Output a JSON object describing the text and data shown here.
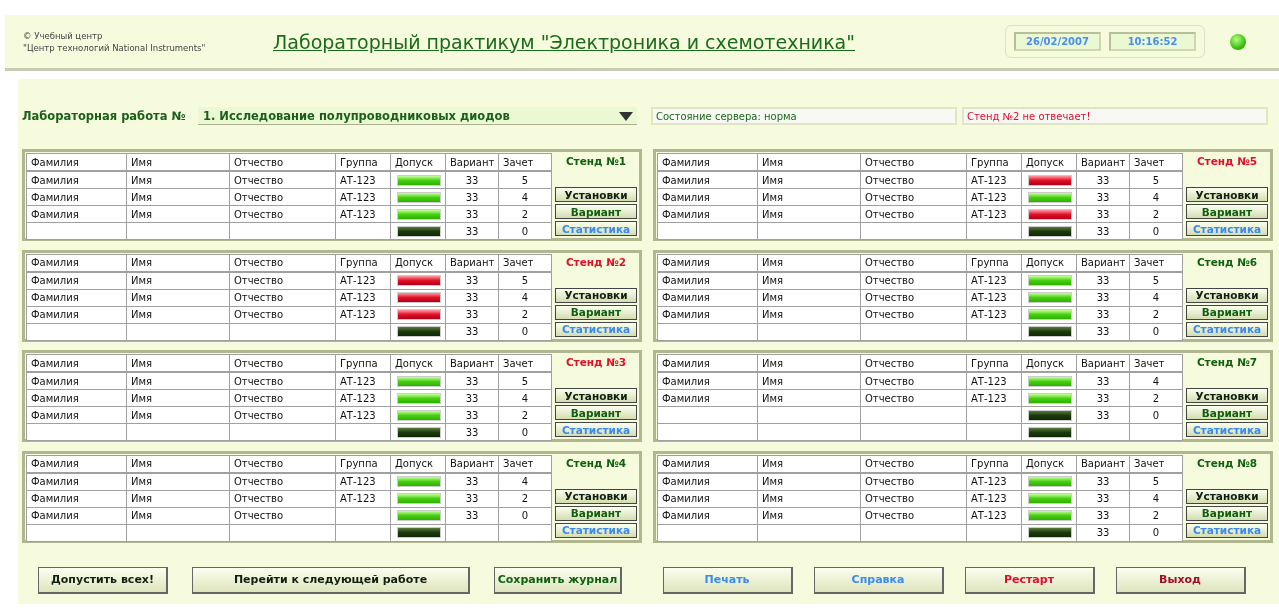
{
  "header": {
    "copyright": "© Учебный центр",
    "org": "\"Центр технологий National Instruments\"",
    "title": "Лабораторный практикум \"Электроника и схемотехника\"",
    "date": "26/02/2007",
    "time": "10:16:52",
    "connected": true
  },
  "lab": {
    "label": "Лабораторная работа №",
    "selected_work": "1. Исследование полупроводниковых диодов"
  },
  "status": {
    "server": "Состояние сервера: норма",
    "alert": "Стенд №2 не отвечает!"
  },
  "stands": [
    {
      "title": "Стенд №1",
      "responding": true,
      "columns": [
        "Фамилия",
        "Имя",
        "Отчество",
        "Группа",
        "Допуск",
        "Вариант",
        "Зачет"
      ],
      "rows": [
        {
          "surname": "Фамилия",
          "name": "Имя",
          "patronymic": "Отчество",
          "group": "АТ-123",
          "kind": "admitted",
          "variant": "33",
          "grade": "5"
        },
        {
          "surname": "Фамилия",
          "name": "Имя",
          "patronymic": "Отчество",
          "group": "АТ-123",
          "kind": "admitted",
          "variant": "33",
          "grade": "4"
        },
        {
          "surname": "Фамилия",
          "name": "Имя",
          "patronymic": "Отчество",
          "group": "АТ-123",
          "kind": "admitted",
          "variant": "33",
          "grade": "2"
        },
        {
          "kind": "blank",
          "variant": "33",
          "grade": "0"
        }
      ],
      "actions": [
        {
          "label": "Установки",
          "kind": "dark"
        },
        {
          "label": "Вариант",
          "kind": "green"
        },
        {
          "label": "Статистика",
          "kind": "blue"
        }
      ]
    },
    {
      "title": "Стенд №2",
      "responding": false,
      "columns": [
        "Фамилия",
        "Имя",
        "Отчество",
        "Группа",
        "Допуск",
        "Вариант",
        "Зачет"
      ],
      "rows": [
        {
          "surname": "Фамилия",
          "name": "Имя",
          "patronymic": "Отчество",
          "group": "АТ-123",
          "kind": "refused",
          "variant": "33",
          "grade": "5"
        },
        {
          "surname": "Фамилия",
          "name": "Имя",
          "patronymic": "Отчество",
          "group": "АТ-123",
          "kind": "refused",
          "variant": "33",
          "grade": "4"
        },
        {
          "surname": "Фамилия",
          "name": "Имя",
          "patronymic": "Отчество",
          "group": "АТ-123",
          "kind": "refused",
          "variant": "33",
          "grade": "2"
        },
        {
          "kind": "blank",
          "variant": "33",
          "grade": "0"
        }
      ],
      "actions": [
        {
          "label": "Установки",
          "kind": "dark"
        },
        {
          "label": "Вариант",
          "kind": "green"
        },
        {
          "label": "Статистика",
          "kind": "blue"
        }
      ]
    },
    {
      "title": "Стенд №3",
      "responding": false,
      "columns": [
        "Фамилия",
        "Имя",
        "Отчество",
        "Группа",
        "Допуск",
        "Вариант",
        "Зачет"
      ],
      "rows": [
        {
          "surname": "Фамилия",
          "name": "Имя",
          "patronymic": "Отчество",
          "group": "АТ-123",
          "kind": "admitted",
          "variant": "33",
          "grade": "5"
        },
        {
          "surname": "Фамилия",
          "name": "Имя",
          "patronymic": "Отчество",
          "group": "АТ-123",
          "kind": "admitted",
          "variant": "33",
          "grade": "4"
        },
        {
          "surname": "Фамилия",
          "name": "Имя",
          "patronymic": "Отчество",
          "group": "АТ-123",
          "kind": "admitted",
          "variant": "33",
          "grade": "2"
        },
        {
          "kind": "blank",
          "variant": "33",
          "grade": "0"
        }
      ],
      "actions": [
        {
          "label": "Установки",
          "kind": "dark"
        },
        {
          "label": "Вариант",
          "kind": "green"
        },
        {
          "label": "Статистика",
          "kind": "blue"
        }
      ]
    },
    {
      "title": "Стенд №4",
      "responding": true,
      "columns": [
        "Фамилия",
        "Имя",
        "Отчество",
        "Группа",
        "Допуск",
        "Вариант",
        "Зачет"
      ],
      "rows": [
        {
          "surname": "Фамилия",
          "name": "Имя",
          "patronymic": "Отчество",
          "group": "АТ-123",
          "kind": "admitted",
          "variant": "33",
          "grade": "4"
        },
        {
          "surname": "Фамилия",
          "name": "Имя",
          "patronymic": "Отчество",
          "group": "АТ-123",
          "kind": "admitted",
          "variant": "33",
          "grade": "2"
        },
        {
          "surname": "Фамилия",
          "name": "Имя",
          "patronymic": "Отчество",
          "kind": "admitted",
          "variant": "33",
          "grade": "0"
        },
        {
          "kind": "blank"
        }
      ],
      "actions": [
        {
          "label": "Установки",
          "kind": "dark"
        },
        {
          "label": "Вариант",
          "kind": "green"
        },
        {
          "label": "Статистика",
          "kind": "blue"
        }
      ]
    },
    {
      "title": "Стенд №5",
      "responding": false,
      "columns": [
        "Фамилия",
        "Имя",
        "Отчество",
        "Группа",
        "Допуск",
        "Вариант",
        "Зачет"
      ],
      "rows": [
        {
          "surname": "Фамилия",
          "name": "Имя",
          "patronymic": "Отчество",
          "group": "АТ-123",
          "kind": "refused",
          "variant": "33",
          "grade": "5"
        },
        {
          "surname": "Фамилия",
          "name": "Имя",
          "patronymic": "Отчество",
          "group": "АТ-123",
          "kind": "admitted",
          "variant": "33",
          "grade": "4"
        },
        {
          "surname": "Фамилия",
          "name": "Имя",
          "patronymic": "Отчество",
          "group": "АТ-123",
          "kind": "refused",
          "variant": "33",
          "grade": "2"
        },
        {
          "kind": "blank",
          "variant": "33",
          "grade": "0"
        }
      ],
      "actions": [
        {
          "label": "Установки",
          "kind": "dark"
        },
        {
          "label": "Вариант",
          "kind": "green"
        },
        {
          "label": "Статистика",
          "kind": "blue"
        }
      ]
    },
    {
      "title": "Стенд №6",
      "responding": true,
      "columns": [
        "Фамилия",
        "Имя",
        "Отчество",
        "Группа",
        "Допуск",
        "Вариант",
        "Зачет"
      ],
      "rows": [
        {
          "surname": "Фамилия",
          "name": "Имя",
          "patronymic": "Отчество",
          "group": "АТ-123",
          "kind": "admitted",
          "variant": "33",
          "grade": "5"
        },
        {
          "surname": "Фамилия",
          "name": "Имя",
          "patronymic": "Отчество",
          "group": "АТ-123",
          "kind": "admitted",
          "variant": "33",
          "grade": "4"
        },
        {
          "surname": "Фамилия",
          "name": "Имя",
          "patronymic": "Отчество",
          "group": "АТ-123",
          "kind": "admitted",
          "variant": "33",
          "grade": "2"
        },
        {
          "kind": "blank",
          "variant": "33",
          "grade": "0"
        }
      ],
      "actions": [
        {
          "label": "Установки",
          "kind": "dark"
        },
        {
          "label": "Вариант",
          "kind": "green"
        },
        {
          "label": "Статистика",
          "kind": "blue"
        }
      ]
    },
    {
      "title": "Стенд №7",
      "responding": true,
      "columns": [
        "Фамилия",
        "Имя",
        "Отчество",
        "Группа",
        "Допуск",
        "Вариант",
        "Зачет"
      ],
      "rows": [
        {
          "surname": "Фамилия",
          "name": "Имя",
          "patronymic": "Отчество",
          "group": "АТ-123",
          "kind": "admitted",
          "variant": "33",
          "grade": "4"
        },
        {
          "surname": "Фамилия",
          "name": "Имя",
          "patronymic": "Отчество",
          "group": "АТ-123",
          "kind": "admitted",
          "variant": "33",
          "grade": "2"
        },
        {
          "kind": "blank",
          "variant": "33",
          "grade": "0"
        },
        {
          "kind": "blank"
        }
      ],
      "actions": [
        {
          "label": "Установки",
          "kind": "dark"
        },
        {
          "label": "Вариант",
          "kind": "green"
        },
        {
          "label": "Статистика",
          "kind": "blue"
        }
      ]
    },
    {
      "title": "Стенд №8",
      "responding": true,
      "columns": [
        "Фамилия",
        "Имя",
        "Отчество",
        "Группа",
        "Допуск",
        "Вариант",
        "Зачет"
      ],
      "rows": [
        {
          "surname": "Фамилия",
          "name": "Имя",
          "patronymic": "Отчество",
          "group": "АТ-123",
          "kind": "admitted",
          "variant": "33",
          "grade": "5"
        },
        {
          "surname": "Фамилия",
          "name": "Имя",
          "patronymic": "Отчество",
          "group": "АТ-123",
          "kind": "admitted",
          "variant": "33",
          "grade": "4"
        },
        {
          "surname": "Фамилия",
          "name": "Имя",
          "patronymic": "Отчество",
          "group": "АТ-123",
          "kind": "admitted",
          "variant": "33",
          "grade": "2"
        },
        {
          "kind": "blank",
          "variant": "33",
          "grade": "0"
        }
      ],
      "actions": [
        {
          "label": "Установки",
          "kind": "dark"
        },
        {
          "label": "Вариант",
          "kind": "green"
        },
        {
          "label": "Статистика",
          "kind": "blue"
        }
      ]
    }
  ],
  "journal_buttons": [
    {
      "label": "Допустить всех!",
      "kind": "dark"
    },
    {
      "label": "Перейти к следующей работе",
      "kind": "dark"
    },
    {
      "label": "Сохранить журнал",
      "kind": "green"
    }
  ],
  "app_buttons": [
    {
      "label": "Печать",
      "kind": "blue"
    },
    {
      "label": "Справка",
      "kind": "blue"
    },
    {
      "label": "Рестарт",
      "kind": "red"
    },
    {
      "label": "Выход",
      "kind": "maroon"
    }
  ]
}
